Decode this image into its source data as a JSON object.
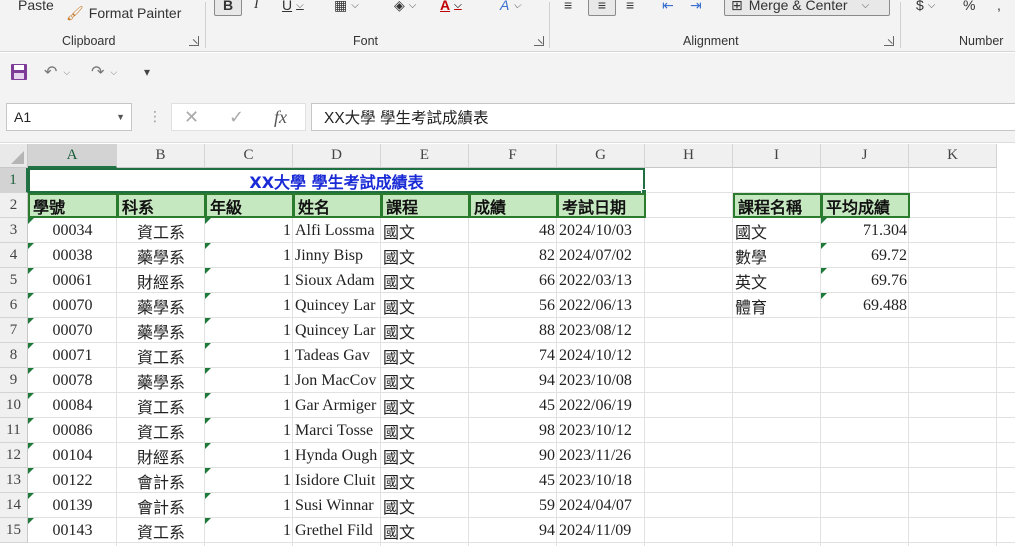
{
  "ribbon": {
    "clipboard": {
      "paste_label": "Paste",
      "format_painter_label": "Format Painter",
      "group_label": "Clipboard"
    },
    "font": {
      "group_label": "Font",
      "bold_label": "B",
      "italic_label": "I",
      "underline_label": "U",
      "font_color_label": "A",
      "text_effects_label": "A"
    },
    "alignment": {
      "group_label": "Alignment",
      "merge_center_label": "Merge & Center"
    },
    "number": {
      "group_label": "Number",
      "currency_label": "$",
      "percent_label": "%"
    }
  },
  "formula_bar": {
    "name_box": "A1",
    "fx_label": "fx",
    "content": "XX大學 學生考試成績表"
  },
  "columns": [
    "A",
    "B",
    "C",
    "D",
    "E",
    "F",
    "G",
    "H",
    "I",
    "J",
    "K"
  ],
  "rows": [
    "1",
    "2",
    "3",
    "4",
    "5",
    "6",
    "7",
    "8",
    "9",
    "10",
    "11",
    "12",
    "13",
    "14",
    "15"
  ],
  "sheet": {
    "title": "XX大學 學生考試成績表",
    "headers": [
      "學號",
      "科系",
      "年級",
      "姓名",
      "課程",
      "成績",
      "考試日期"
    ],
    "records": [
      {
        "id": "00034",
        "dept": "資工系",
        "grade": "1",
        "name": "Alfi Lossma",
        "course": "國文",
        "score": "48",
        "date": "2024/10/03"
      },
      {
        "id": "00038",
        "dept": "藥學系",
        "grade": "1",
        "name": "Jinny Bisp",
        "course": "國文",
        "score": "82",
        "date": "2024/07/02"
      },
      {
        "id": "00061",
        "dept": "財經系",
        "grade": "1",
        "name": "Sioux Adam",
        "course": "國文",
        "score": "66",
        "date": "2022/03/13"
      },
      {
        "id": "00070",
        "dept": "藥學系",
        "grade": "1",
        "name": "Quincey Lar",
        "course": "國文",
        "score": "56",
        "date": "2022/06/13"
      },
      {
        "id": "00070",
        "dept": "藥學系",
        "grade": "1",
        "name": "Quincey Lar",
        "course": "國文",
        "score": "88",
        "date": "2023/08/12"
      },
      {
        "id": "00071",
        "dept": "資工系",
        "grade": "1",
        "name": "Tadeas Gav",
        "course": "國文",
        "score": "74",
        "date": "2024/10/12"
      },
      {
        "id": "00078",
        "dept": "藥學系",
        "grade": "1",
        "name": "Jon MacCov",
        "course": "國文",
        "score": "94",
        "date": "2023/10/08"
      },
      {
        "id": "00084",
        "dept": "資工系",
        "grade": "1",
        "name": "Gar Armiger",
        "course": "國文",
        "score": "45",
        "date": "2022/06/19"
      },
      {
        "id": "00086",
        "dept": "資工系",
        "grade": "1",
        "name": "Marci Tosse",
        "course": "國文",
        "score": "98",
        "date": "2023/10/12"
      },
      {
        "id": "00104",
        "dept": "財經系",
        "grade": "1",
        "name": "Hynda Ough",
        "course": "國文",
        "score": "90",
        "date": "2023/11/26"
      },
      {
        "id": "00122",
        "dept": "會計系",
        "grade": "1",
        "name": "Isidore Cluit",
        "course": "國文",
        "score": "45",
        "date": "2023/10/18"
      },
      {
        "id": "00139",
        "dept": "會計系",
        "grade": "1",
        "name": "Susi Winnar",
        "course": "國文",
        "score": "59",
        "date": "2024/04/07"
      },
      {
        "id": "00143",
        "dept": "資工系",
        "grade": "1",
        "name": "Grethel Fild",
        "course": "國文",
        "score": "94",
        "date": "2024/11/09"
      }
    ],
    "summary_headers": [
      "課程名稱",
      "平均成績"
    ],
    "summary": [
      {
        "course": "國文",
        "avg": "71.304"
      },
      {
        "course": "數學",
        "avg": "69.72"
      },
      {
        "course": "英文",
        "avg": "69.76"
      },
      {
        "course": "體育",
        "avg": "69.488"
      }
    ]
  },
  "colors": {
    "accent": "#217346",
    "header_fill": "#c6e8c0",
    "title_text": "#1a2bd6"
  }
}
